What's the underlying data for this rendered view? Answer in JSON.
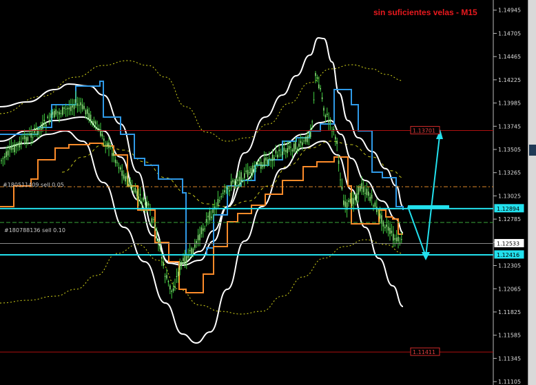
{
  "chart_title": "sin suficientes velas - M15",
  "price_axis": {
    "ticks": [
      "1.14945",
      "1.14705",
      "1.14465",
      "1.14225",
      "1.13985",
      "1.13745",
      "1.13505",
      "1.13265",
      "1.13025",
      "1.12785",
      "1.12545",
      "1.12305",
      "1.12065",
      "1.11825",
      "1.11585",
      "1.11345",
      "1.11105"
    ]
  },
  "price_tags": {
    "high_level": "1.13701",
    "upper_cyan": "1.12894",
    "current": "1.12533",
    "lower_cyan": "1.12416",
    "low_level": "1.11411"
  },
  "order_labels": {
    "order1": "#180511409 sell 0.05",
    "order2": "#180788136 sell 0.10"
  },
  "colors": {
    "background": "#000000",
    "title": "#e8191e",
    "level_line": "#b01010",
    "cyan": "#22e1ee",
    "blue_band": "#2f9ae8",
    "orange_band": "#ff8c2a",
    "white_band": "#ffffff",
    "candle": "#40d040",
    "yellow_dots": "#d9d91a"
  },
  "chart_data": {
    "type": "candlestick",
    "y_range": [
      1.1107,
      1.1505
    ],
    "horizontal_levels": [
      1.13701,
      1.12894,
      1.12533,
      1.12416,
      1.11411
    ],
    "pending_sell_orders": [
      1.1312,
      1.1275
    ]
  }
}
